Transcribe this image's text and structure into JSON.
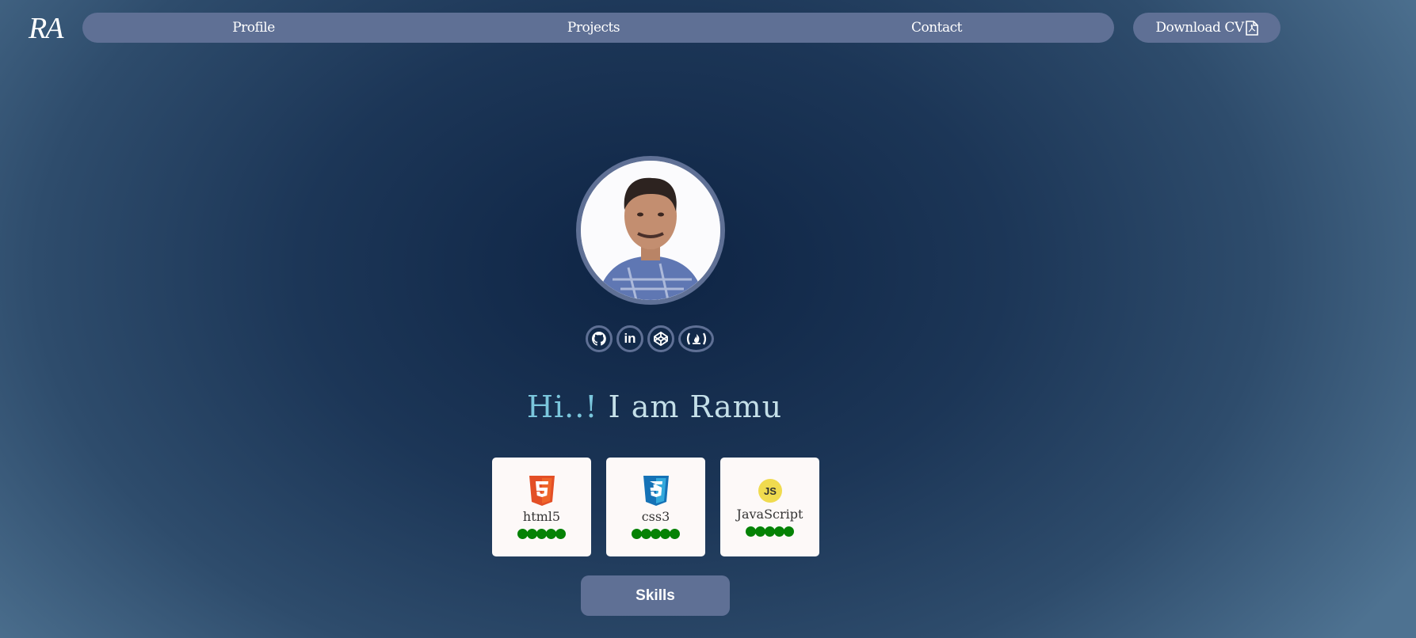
{
  "header": {
    "logo": "RA",
    "nav": [
      {
        "label": "Profile"
      },
      {
        "label": "Projects"
      },
      {
        "label": "Contact"
      }
    ],
    "download_label": "Download CV",
    "download_icon": "pdf-file-icon"
  },
  "profile": {
    "socials": [
      "github-icon",
      "linkedin-icon",
      "codepen-icon",
      "freecodecamp-icon"
    ],
    "greeting_hi": "Hi..!",
    "greeting_rest": " I am Ramu"
  },
  "skills": [
    {
      "name": "html5",
      "icon": "html5-icon",
      "rating": 5,
      "max": 5
    },
    {
      "name": "css3",
      "icon": "css3-icon",
      "rating": 5,
      "max": 5
    },
    {
      "name": "JavaScript",
      "icon": "javascript-icon",
      "rating": 5,
      "max": 5
    }
  ],
  "skills_button": "Skills",
  "colors": {
    "accent": "#5f7095",
    "rating": "#058205"
  }
}
